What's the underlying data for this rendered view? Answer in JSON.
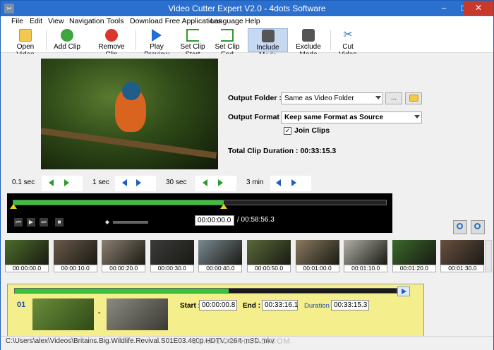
{
  "window": {
    "title": "Video Cutter Expert V2.0 - 4dots Software",
    "minimize": "–",
    "maximize": "□",
    "close": "✕"
  },
  "menu": [
    "File",
    "Edit",
    "View",
    "Navigation",
    "Tools",
    "Download Free Applications",
    "Language",
    "Help"
  ],
  "toolbar": {
    "open_video": "Open Video",
    "add_clip": "Add Clip",
    "remove_clip": "Remove Clip",
    "play_preview": "Play Preview",
    "set_clip_start": "Set Clip Start",
    "set_clip_end": "Set Clip End",
    "include_mode": "Include Mode",
    "exclude_mode": "Exclude Mode",
    "cut_video": "Cut Video"
  },
  "output": {
    "folder_label": "Output Folder :",
    "folder_value": "Same as Video Folder",
    "browse": "...",
    "format_label": "Output Format :",
    "format_value": "Keep same Format as Source",
    "join_clips": "Join Clips",
    "join_checked": "✓",
    "total_label": "Total Clip Duration : 00:33:15.3"
  },
  "steps": {
    "s1": "0.1 sec",
    "s2": "1 sec",
    "s3": "30 sec",
    "s4": "3 min"
  },
  "player": {
    "current": "00:00:00.0",
    "total": "/ 00:58:56.3",
    "progress": 0.01,
    "clip_start": 0.0,
    "clip_end": 0.565
  },
  "thumbnails": [
    "00:00:00.0",
    "00:00:10.0",
    "00:00:20.0",
    "00:00:30.0",
    "00:00:40.0",
    "00:00:50.0",
    "00:01:00.0",
    "00:01:10.0",
    "00:01:20.0",
    "00:01:30.0"
  ],
  "clip": {
    "number": "01",
    "dash": "-",
    "start_label": "Start :",
    "start": "00:00:00.8",
    "end_label": "End :",
    "end": "00:33:16.1",
    "duration_label": "Duration :",
    "duration": "00:33:15.3",
    "progress": 0.56
  },
  "status": {
    "path": "C:\\Users\\alex\\Videos\\Britains.Big.Wildlife.Revival.S01E03.480p.HDTV.x264-mSD.mkv",
    "watermark": "GEARDOWNLOAD.COM"
  }
}
